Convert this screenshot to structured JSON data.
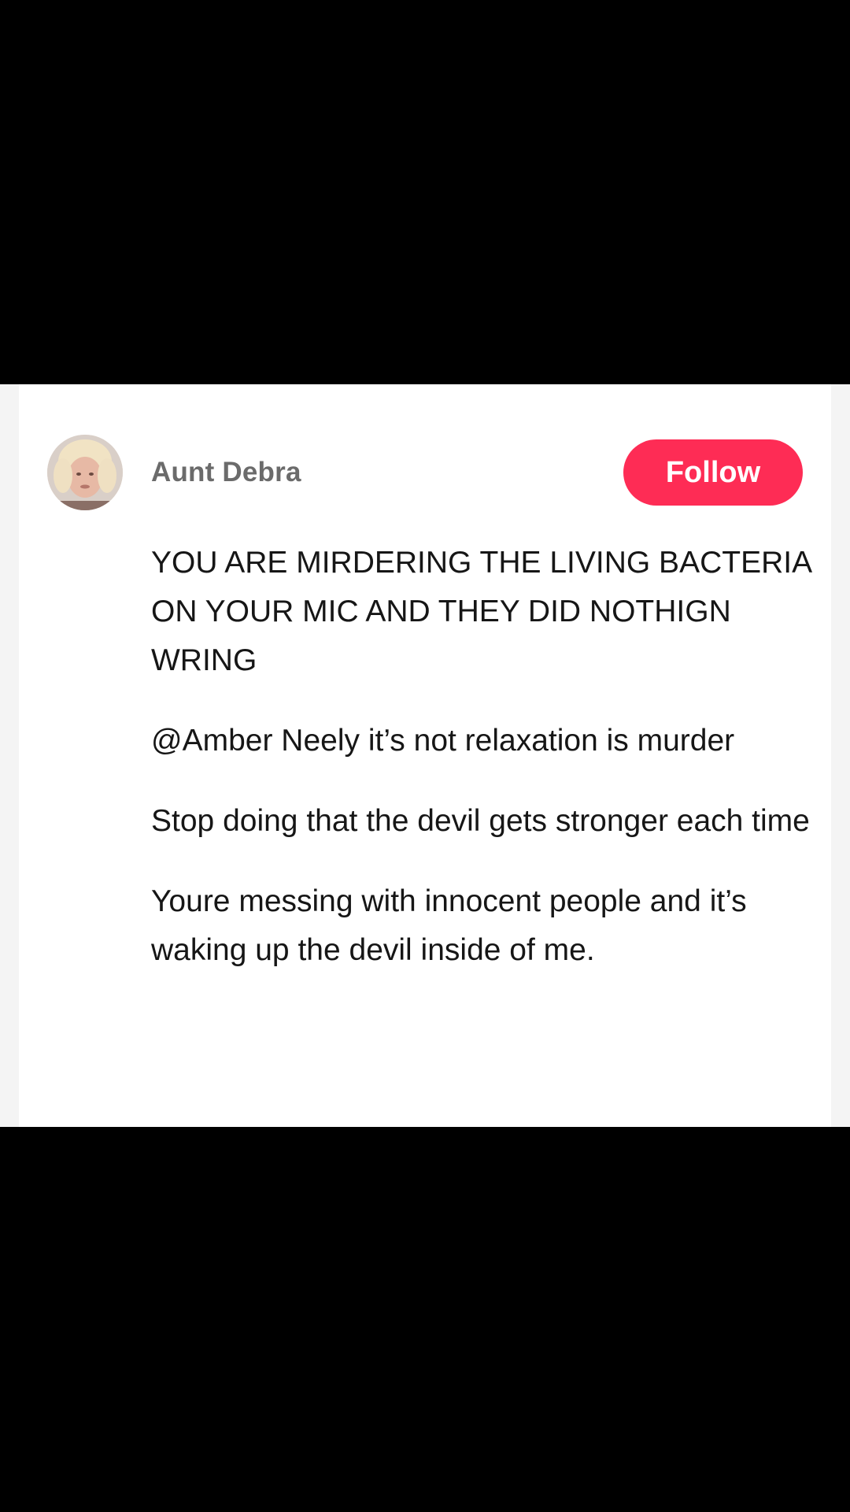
{
  "comment_card": {
    "username": "Aunt Debra",
    "follow_label": "Follow",
    "colors": {
      "follow_button": "#fe2c55",
      "username": "#6b6b6b",
      "text": "#161616",
      "card": "#ffffff",
      "letterbox": "#000000"
    },
    "comments": [
      {
        "text": "YOU ARE MIRDERING THE LIVING BACTERIA ON YOUR MIC AND THEY DID NOTHIGN WRING"
      },
      {
        "text": "@Amber Neely it’s not relaxation is murder"
      },
      {
        "text": "Stop doing that the devil gets stronger each time"
      },
      {
        "text": "Youre messing with innocent people and it’s waking up the devil inside of me."
      }
    ]
  }
}
